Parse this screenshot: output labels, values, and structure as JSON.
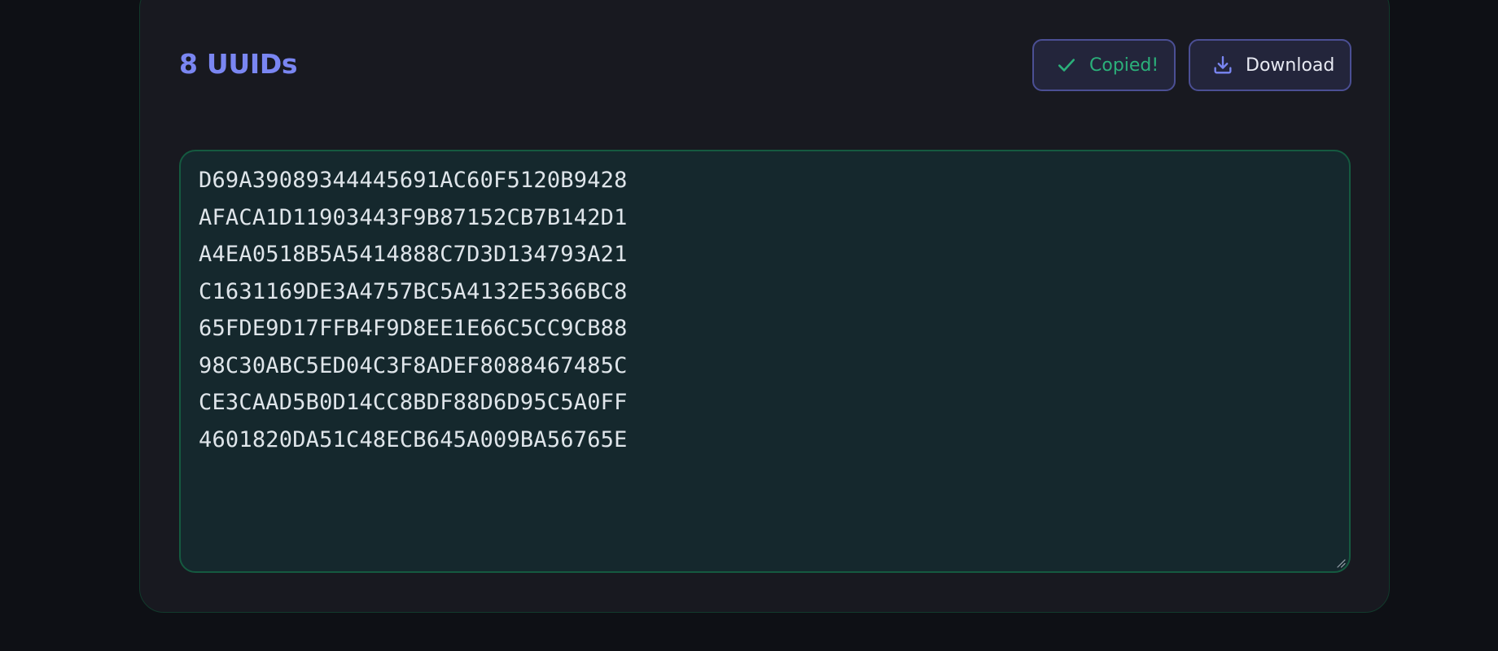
{
  "header": {
    "title": "8 UUIDs"
  },
  "toolbar": {
    "copy_label": "Copied!",
    "copy_icon": "check-icon",
    "download_label": "Download",
    "download_icon": "download-icon"
  },
  "output": {
    "uuids": [
      "D69A39089344445691AC60F5120B9428",
      "AFACA1D11903443F9B87152CB7B142D1",
      "A4EA0518B5A5414888C7D3D134793A21",
      "C1631169DE3A4757BC5A4132E5366BC8",
      "65FDE9D17FFB4F9D8EE1E66C5CC9CB88",
      "98C30ABC5ED04C3F8ADEF8088467485C",
      "CE3CAAD5B0D14CC8BDF88D6D95C5A0FF",
      "4601820DA51C48ECB645A009BA56765E"
    ]
  },
  "colors": {
    "accent": "#7a86f2",
    "success": "#2bb07a",
    "border_green": "#155a40"
  }
}
